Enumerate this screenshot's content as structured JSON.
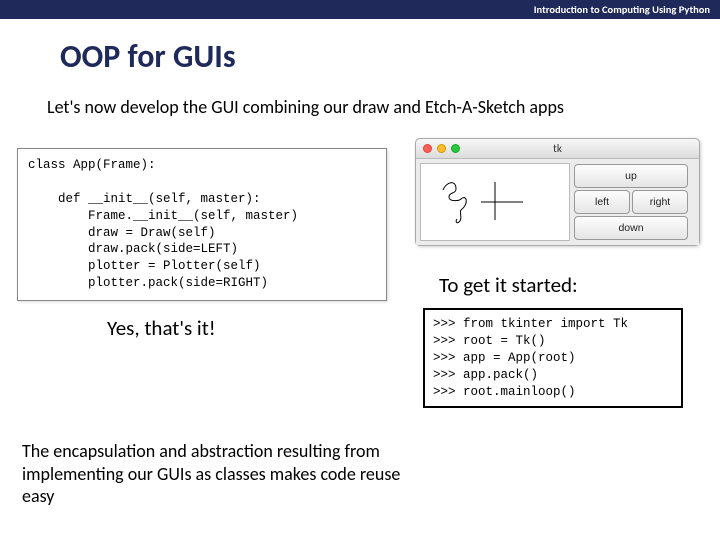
{
  "header": "Introduction to Computing Using Python",
  "title": "OOP for GUIs",
  "intro": "Let's now develop the GUI combining our draw and Etch-A-Sketch apps",
  "code_class": "class App(Frame):\n\n    def __init__(self, master):\n        Frame.__init__(self, master)\n        draw = Draw(self)\n        draw.pack(side=LEFT)\n        plotter = Plotter(self)\n        plotter.pack(side=RIGHT)",
  "yes_thats_it": "Yes, that's it!",
  "conclusion": "The encapsulation and abstraction resulting from implementing our GUIs as classes makes code reuse easy",
  "tk_window": {
    "title": "tk",
    "buttons": {
      "up": "up",
      "left": "left",
      "right": "right",
      "down": "down"
    }
  },
  "to_get": "To get it started:",
  "repl": ">>> from tkinter import Tk\n>>> root = Tk()\n>>> app = App(root)\n>>> app.pack()\n>>> root.mainloop()"
}
